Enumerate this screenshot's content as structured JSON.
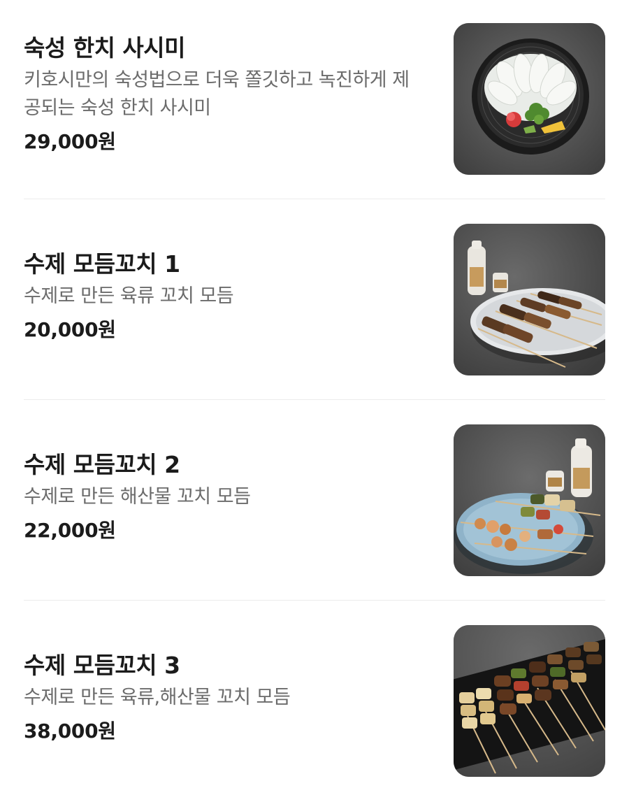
{
  "menu": {
    "items": [
      {
        "name": "숙성 한치 사시미",
        "description": "키호시만의 숙성법으로 더욱 쫄깃하고 녹진하게 제공되는 숙성 한치 사시미",
        "price": "29,000원",
        "image_icon": "squid-sashimi-plate-image"
      },
      {
        "name": "수제 모듬꼬치 1",
        "description": "수제로 만든 육류 꼬치 모듬",
        "price": "20,000원",
        "image_icon": "meat-skewers-plate-image"
      },
      {
        "name": "수제 모듬꼬치 2",
        "description": "수제로 만든 해산물 꼬치 모듬",
        "price": "22,000원",
        "image_icon": "seafood-skewers-plate-image"
      },
      {
        "name": "수제 모듬꼬치 3",
        "description": "수제로 만든 육류,해산물 꼬치 모듬",
        "price": "38,000원",
        "image_icon": "mixed-skewers-tray-image"
      }
    ]
  },
  "colors": {
    "name_text": "#1b1b1b",
    "description_text": "#6b6b6b",
    "divider": "#ececec",
    "photo_background": "#5d5d5d"
  }
}
